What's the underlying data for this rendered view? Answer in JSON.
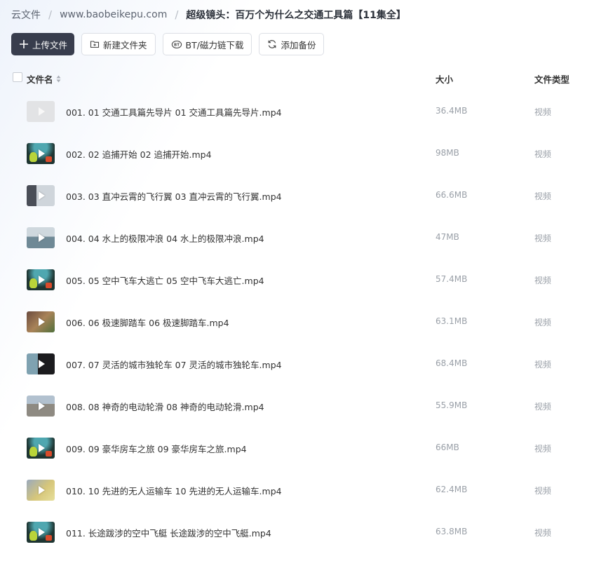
{
  "breadcrumb": {
    "root": "云文件",
    "level1": "www.baobeikepu.com",
    "current": "超级镜头：百万个为什么之交通工具篇【11集全】"
  },
  "toolbar": {
    "upload": "上传文件",
    "new_folder": "新建文件夹",
    "bt": "BT/磁力链下载",
    "backup": "添加备份"
  },
  "table": {
    "columns": {
      "name": "文件名",
      "size": "大小",
      "type": "文件类型"
    },
    "rows": [
      {
        "name": "001. 01 交通工具篇先导片 01 交通工具篇先导片.mp4",
        "size": "36.4MB",
        "type": "视频",
        "thumb": "blank"
      },
      {
        "name": "002. 02 追捕开始 02 追捕开始.mp4",
        "size": "98MB",
        "type": "视频",
        "thumb": "cartoon"
      },
      {
        "name": "003. 03 直冲云霄的飞行翼 03 直冲云霄的飞行翼.mp4",
        "size": "66.6MB",
        "type": "视频",
        "thumb": "jet"
      },
      {
        "name": "004. 04 水上的极限冲浪 04 水上的极限冲浪.mp4",
        "size": "47MB",
        "type": "视频",
        "thumb": "water"
      },
      {
        "name": "005. 05 空中飞车大逃亡 05 空中飞车大逃亡.mp4",
        "size": "57.4MB",
        "type": "视频",
        "thumb": "cartoon"
      },
      {
        "name": "006. 06 极速脚踏车 06 极速脚踏车.mp4",
        "size": "63.1MB",
        "type": "视频",
        "thumb": "bike"
      },
      {
        "name": "007. 07 灵活的城市独轮车 07 灵活的城市独轮车.mp4",
        "size": "68.4MB",
        "type": "视频",
        "thumb": "unicycle"
      },
      {
        "name": "008. 08 神奇的电动轮滑 08 神奇的电动轮滑.mp4",
        "size": "55.9MB",
        "type": "视频",
        "thumb": "road"
      },
      {
        "name": "009. 09 豪华房车之旅 09 豪华房车之旅.mp4",
        "size": "66MB",
        "type": "视频",
        "thumb": "cartoon"
      },
      {
        "name": "010. 10 先进的无人运输车 10 先进的无人运输车.mp4",
        "size": "62.4MB",
        "type": "视频",
        "thumb": "van"
      },
      {
        "name": "011. 长途跋涉的空中飞艇 长途跋涉的空中飞艇.mp4",
        "size": "63.8MB",
        "type": "视频",
        "thumb": "cartoon"
      }
    ]
  },
  "icons": {
    "upload": "plus-icon",
    "new_folder": "folder-plus-icon",
    "bt": "bt-icon",
    "backup": "sync-icon",
    "sort": "sort-icon",
    "play": "play-icon"
  },
  "colors": {
    "primary_button": "#383d4d",
    "muted_text": "#9aa0a8"
  }
}
